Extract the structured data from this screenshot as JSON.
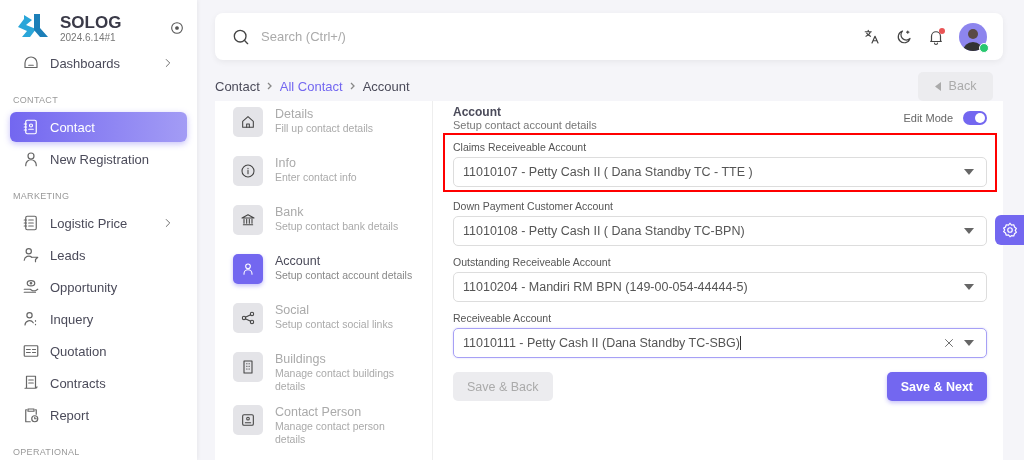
{
  "brand": {
    "name": "SOLOG",
    "version": "2024.6.14#1"
  },
  "sidebar": {
    "items": [
      {
        "kind": "item",
        "label": "Dashboards",
        "expandable": true,
        "selected": false
      },
      {
        "kind": "section",
        "label": "CONTACT"
      },
      {
        "kind": "item",
        "label": "Contact",
        "expandable": false,
        "selected": true
      },
      {
        "kind": "item",
        "label": "New Registration",
        "expandable": false,
        "selected": false
      },
      {
        "kind": "section",
        "label": "MARKETING"
      },
      {
        "kind": "item",
        "label": "Logistic Price",
        "expandable": true,
        "selected": false
      },
      {
        "kind": "item",
        "label": "Leads",
        "expandable": false,
        "selected": false
      },
      {
        "kind": "item",
        "label": "Opportunity",
        "expandable": false,
        "selected": false
      },
      {
        "kind": "item",
        "label": "Inquery",
        "expandable": false,
        "selected": false
      },
      {
        "kind": "item",
        "label": "Quotation",
        "expandable": false,
        "selected": false
      },
      {
        "kind": "item",
        "label": "Contracts",
        "expandable": false,
        "selected": false
      },
      {
        "kind": "item",
        "label": "Report",
        "expandable": false,
        "selected": false
      },
      {
        "kind": "section",
        "label": "OPERATIONAL"
      }
    ]
  },
  "header": {
    "search": {
      "placeholder": "Search (Ctrl+/)"
    },
    "notifications": {
      "unread": true
    },
    "avatar": {
      "online": true
    }
  },
  "breadcrumb": [
    {
      "label": "Contact",
      "link": false
    },
    {
      "label": "All Contact",
      "link": true
    },
    {
      "label": "Account",
      "link": false
    }
  ],
  "back_button": {
    "label": "Back",
    "disabled": true
  },
  "steps": [
    {
      "title": "Details",
      "subtitle": "Fill up contact details",
      "selected": false
    },
    {
      "title": "Info",
      "subtitle": "Enter contact info",
      "selected": false
    },
    {
      "title": "Bank",
      "subtitle": "Setup contact bank details",
      "selected": false
    },
    {
      "title": "Account",
      "subtitle": "Setup contact account details",
      "selected": true
    },
    {
      "title": "Social",
      "subtitle": "Setup contact social links",
      "selected": false
    },
    {
      "title": "Buildings",
      "subtitle": "Manage contact buildings details",
      "selected": false
    },
    {
      "title": "Contact Person",
      "subtitle": "Manage contact person details",
      "selected": false
    }
  ],
  "form": {
    "title": "Account",
    "subtitle": "Setup contact account details",
    "edit_mode": {
      "label": "Edit Mode",
      "on": true
    },
    "fields": [
      {
        "label": "Claims Receiveable Account",
        "value": "11010107 - Petty Cash II ( Dana Standby TC - TTE )",
        "highlighted": true,
        "focused": false
      },
      {
        "label": "Down Payment Customer Account",
        "value": "11010108 - Petty Cash II ( Dana Standby TC-BPN)",
        "highlighted": false,
        "focused": false
      },
      {
        "label": "Outstanding Receiveable Account",
        "value": "11010204 - Mandiri RM BPN (149-00-054-44444-5)",
        "highlighted": false,
        "focused": false
      },
      {
        "label": "Receiveable Account",
        "value": "11010111 - Petty Cash II (Dana Standby TC-SBG)",
        "highlighted": false,
        "focused": true
      }
    ],
    "buttons": [
      {
        "label": "Save & Back",
        "disabled": true
      },
      {
        "label": "Save & Next",
        "disabled": false
      }
    ]
  }
}
